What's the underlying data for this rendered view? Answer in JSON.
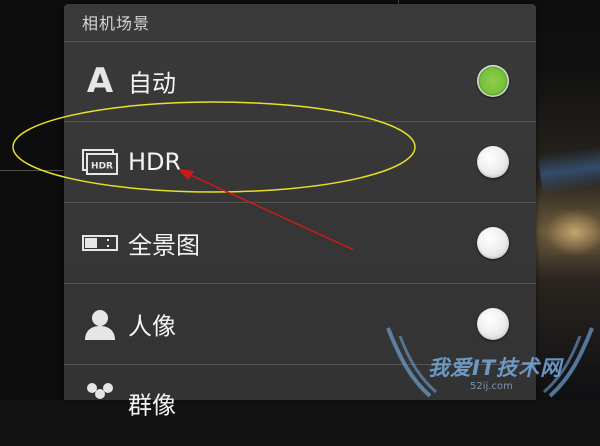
{
  "panel": {
    "title": "相机场景"
  },
  "scenes": [
    {
      "id": "auto",
      "label": "自动",
      "icon": "auto-a-icon",
      "selected": true
    },
    {
      "id": "hdr",
      "label": "HDR",
      "icon": "hdr-icon",
      "selected": false
    },
    {
      "id": "panorama",
      "label": "全景图",
      "icon": "panorama-icon",
      "selected": false
    },
    {
      "id": "portrait",
      "label": "人像",
      "icon": "person-icon",
      "selected": false
    },
    {
      "id": "group",
      "label": "群像",
      "icon": "group-icon",
      "selected": false
    }
  ],
  "icon_glyphs": {
    "auto": "A",
    "hdr": "HDR"
  },
  "colors": {
    "selected_radio": "#78c03a",
    "annotation_ellipse": "#e8e02a",
    "annotation_arrow": "#d01818"
  },
  "watermark": {
    "text": "我爱IT技术网",
    "url": "52ij.com"
  }
}
